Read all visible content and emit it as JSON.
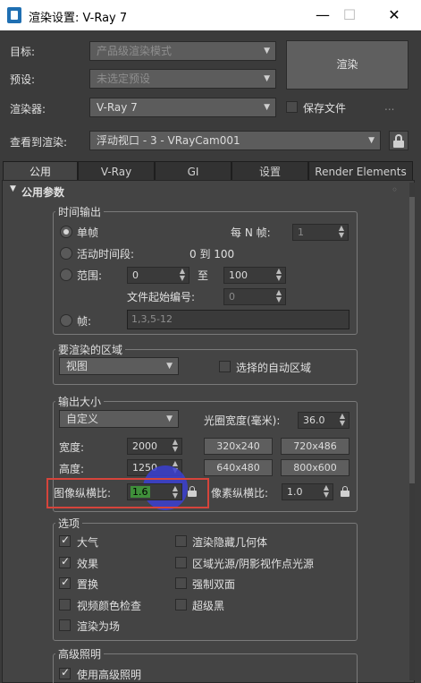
{
  "window": {
    "title": "渲染设置: V-Ray 7",
    "minimize": "—",
    "maximize": "☐",
    "close": "✕"
  },
  "header": {
    "target_label": "目标:",
    "target_value": "产品级渲染模式",
    "preset_label": "预设:",
    "preset_value": "未选定预设",
    "renderer_label": "渲染器:",
    "renderer_value": "V-Ray 7",
    "save_file_label": "保存文件",
    "ellipsis": "...",
    "render_button": "渲染",
    "view_label": "查看到渲染:",
    "view_value": "浮动视口 - 3 - VRayCam001"
  },
  "tabs": [
    "公用",
    "V-Ray",
    "GI",
    "设置",
    "Render Elements"
  ],
  "rollout": {
    "title": "公用参数",
    "time_output": {
      "title": "时间输出",
      "single_label": "单帧",
      "every_n_label": "每 N 帧:",
      "every_n_value": "1",
      "active_segment_label": "活动时间段:",
      "active_segment_range": "0 到 100",
      "range_label": "范围:",
      "range_from": "0",
      "range_to_label": "至",
      "range_to": "100",
      "file_start_label": "文件起始编号:",
      "file_start_value": "0",
      "frames_label": "帧:",
      "frames_value": "1,3,5-12"
    },
    "area": {
      "title": "要渲染的区域",
      "dropdown_value": "视图",
      "auto_region_label": "选择的自动区域"
    },
    "output_size": {
      "title": "输出大小",
      "preset_value": "自定义",
      "aperture_label": "光圈宽度(毫米):",
      "aperture_value": "36.0",
      "width_label": "宽度:",
      "width_value": "2000",
      "height_label": "高度:",
      "height_value": "1250",
      "presets": [
        "320x240",
        "720x486",
        "640x480",
        "800x600"
      ],
      "image_aspect_label": "图像纵横比:",
      "image_aspect_value": "1.6",
      "pixel_aspect_label": "像素纵横比:",
      "pixel_aspect_value": "1.0"
    },
    "options": {
      "title": "选项",
      "left": [
        {
          "label": "大气",
          "checked": true
        },
        {
          "label": "效果",
          "checked": true
        },
        {
          "label": "置换",
          "checked": true
        },
        {
          "label": "视频颜色检查",
          "checked": false
        },
        {
          "label": "渲染为场",
          "checked": false
        }
      ],
      "right": [
        {
          "label": "渲染隐藏几何体",
          "checked": false
        },
        {
          "label": "区域光源/阴影视作点光源",
          "checked": false
        },
        {
          "label": "强制双面",
          "checked": false
        },
        {
          "label": "超级黑",
          "checked": false
        }
      ]
    },
    "advanced_lighting": {
      "title": "高级照明",
      "use_label": "使用高级照明",
      "use_checked": true
    }
  },
  "colors": {
    "highlight_box": "#d6443b",
    "cursor_circle": "#3b3fd1",
    "accent_green": "#3f8f3a",
    "tab_active_bg": "#444444"
  }
}
